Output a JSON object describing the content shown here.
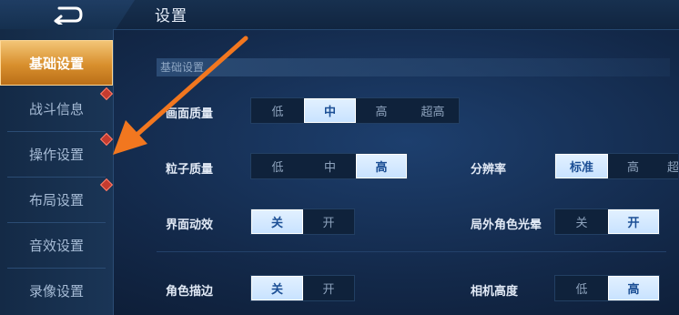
{
  "header": {
    "title": "设置"
  },
  "sidebar": {
    "items": [
      {
        "label": "基础设置"
      },
      {
        "label": "战斗信息"
      },
      {
        "label": "操作设置"
      },
      {
        "label": "布局设置"
      },
      {
        "label": "音效设置"
      },
      {
        "label": "录像设置"
      }
    ]
  },
  "section": {
    "title": "基础设置"
  },
  "settings": {
    "quality": {
      "label": "画面质量",
      "options": [
        "低",
        "中",
        "高",
        "超高"
      ],
      "selected": "中"
    },
    "particle": {
      "label": "粒子质量",
      "options": [
        "低",
        "中",
        "高"
      ],
      "selected": "高"
    },
    "resolution": {
      "label": "分辨率",
      "options": [
        "标准",
        "高",
        "超"
      ],
      "selected": "标准"
    },
    "ui_effect": {
      "label": "界面动效",
      "options": [
        "关",
        "开"
      ],
      "selected": "关"
    },
    "halo": {
      "label": "局外角色光晕",
      "options": [
        "关",
        "开"
      ],
      "selected": "开"
    },
    "outline": {
      "label": "角色描边",
      "options": [
        "关",
        "开"
      ],
      "selected": "关"
    },
    "camera": {
      "label": "相机高度",
      "options": [
        "低",
        "高"
      ],
      "selected": "高"
    }
  },
  "colors": {
    "accent": "#d88f2d",
    "selected_bg": "#dcefff",
    "annotation_arrow": "#f2771f",
    "badge": "#c43b2f"
  }
}
